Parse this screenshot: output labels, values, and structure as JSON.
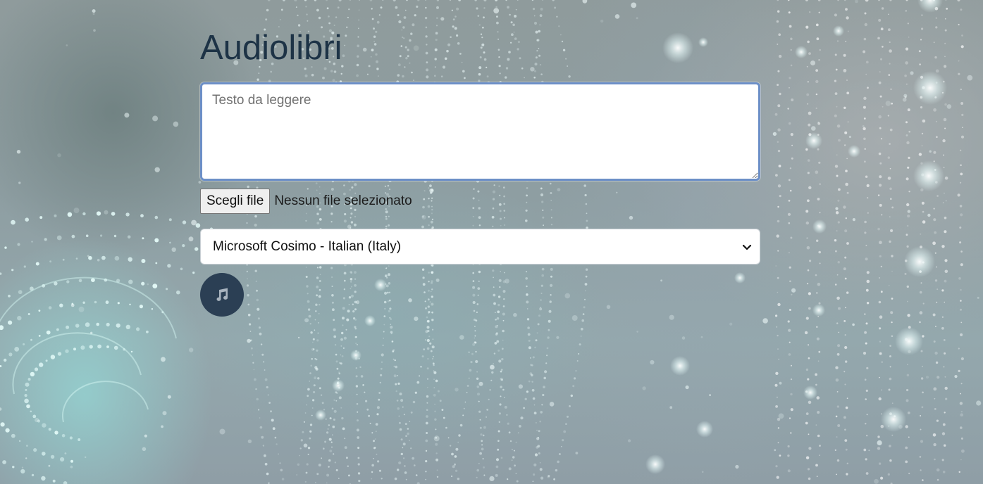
{
  "page": {
    "title": "Audiolibri"
  },
  "text_input": {
    "placeholder": "Testo da leggere",
    "value": ""
  },
  "file_picker": {
    "button_label": "Scegli file",
    "status": "Nessun file selezionato"
  },
  "voice_select": {
    "selected": "Microsoft Cosimo - Italian (Italy)"
  },
  "play_button": {
    "icon": "music-note-icon"
  },
  "colors": {
    "title": "#1d3346",
    "focus_border": "#6c8fc7",
    "play_button_bg": "#2b3f54",
    "music_icon": "#a9b4bf"
  }
}
